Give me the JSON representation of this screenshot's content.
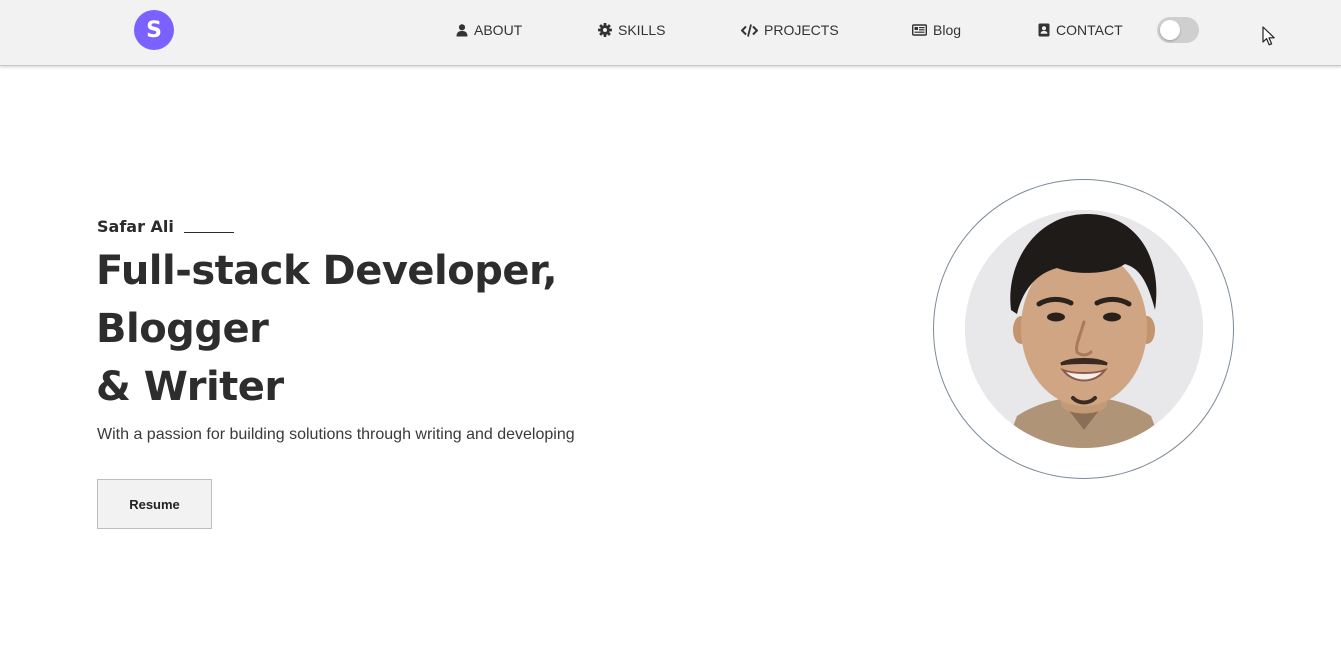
{
  "nav": {
    "logo_letter": "S",
    "items": [
      {
        "label": "ABOUT",
        "icon": "user-icon"
      },
      {
        "label": "SKILLS",
        "icon": "gear-icon"
      },
      {
        "label": "PROJECTS",
        "icon": "code-icon"
      },
      {
        "label": "Blog",
        "icon": "newspaper-icon"
      },
      {
        "label": "CONTACT",
        "icon": "contact-card-icon"
      }
    ],
    "theme_toggle": {
      "state": "off"
    }
  },
  "hero": {
    "name": "Safar Ali",
    "title_lines": [
      "Full-stack Developer,",
      "Blogger",
      "& Writer"
    ],
    "subtitle": "With a passion for building solutions through writing and developing",
    "resume_label": "Resume"
  },
  "colors": {
    "brand": "#7b61ff",
    "navbar_bg": "#f2f2f2",
    "text": "#2b2b2b",
    "ring": "#7d8a96"
  }
}
